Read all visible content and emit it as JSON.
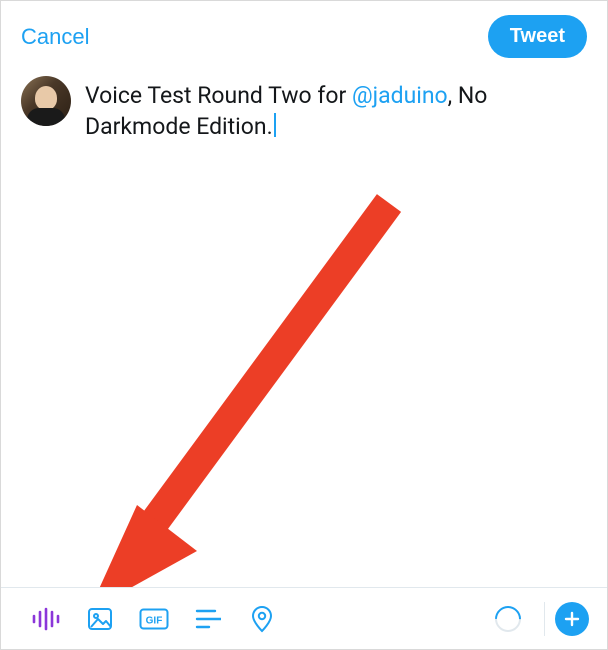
{
  "header": {
    "cancel_label": "Cancel",
    "tweet_label": "Tweet"
  },
  "compose": {
    "text_before_mention": "Voice Test Round Two for ",
    "mention": "@jaduino",
    "text_after_mention": ", No Darkmode Edition."
  },
  "toolbar": {
    "voice_icon": "voice-wave-icon",
    "image_icon": "image-icon",
    "gif_icon": "gif-icon",
    "poll_icon": "poll-icon",
    "location_icon": "location-pin-icon",
    "char_counter": "character-count-ring",
    "add_thread": "add-tweet-button"
  },
  "colors": {
    "accent": "#1da1f2",
    "voice_accent": "#8b36d9",
    "text": "#14171a",
    "arrow": "#ec3e26"
  }
}
